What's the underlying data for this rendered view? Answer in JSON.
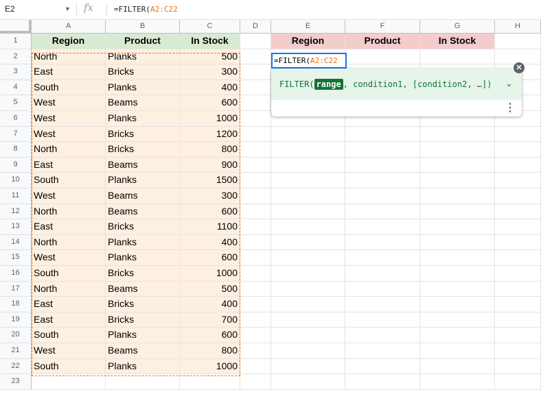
{
  "formula_bar": {
    "cell_ref": "E2",
    "fx_icon": "fx-icon",
    "formula_prefix": "=FILTER(",
    "formula_range": "A2:C22"
  },
  "columns": [
    "A",
    "B",
    "C",
    "D",
    "E",
    "F",
    "G",
    "H"
  ],
  "rows": [
    "1",
    "2",
    "3",
    "4",
    "5",
    "6",
    "7",
    "8",
    "9",
    "10",
    "11",
    "12",
    "13",
    "14",
    "15",
    "16",
    "17",
    "18",
    "19",
    "20",
    "21",
    "22",
    "23"
  ],
  "source_headers": [
    "Region",
    "Product",
    "In Stock"
  ],
  "source_data": [
    [
      "North",
      "Planks",
      "500"
    ],
    [
      "East",
      "Bricks",
      "300"
    ],
    [
      "South",
      "Planks",
      "400"
    ],
    [
      "West",
      "Beams",
      "600"
    ],
    [
      "West",
      "Planks",
      "1000"
    ],
    [
      "West",
      "Bricks",
      "1200"
    ],
    [
      "North",
      "Bricks",
      "800"
    ],
    [
      "East",
      "Beams",
      "900"
    ],
    [
      "South",
      "Planks",
      "1500"
    ],
    [
      "West",
      "Beams",
      "300"
    ],
    [
      "North",
      "Beams",
      "600"
    ],
    [
      "East",
      "Bricks",
      "1100"
    ],
    [
      "North",
      "Planks",
      "400"
    ],
    [
      "West",
      "Planks",
      "600"
    ],
    [
      "South",
      "Bricks",
      "1000"
    ],
    [
      "North",
      "Beams",
      "500"
    ],
    [
      "East",
      "Bricks",
      "400"
    ],
    [
      "East",
      "Bricks",
      "700"
    ],
    [
      "South",
      "Planks",
      "600"
    ],
    [
      "West",
      "Beams",
      "800"
    ],
    [
      "South",
      "Planks",
      "1000"
    ]
  ],
  "output_headers": [
    "Region",
    "Product",
    "In Stock"
  ],
  "active_cell": {
    "prefix": "=FILTER(",
    "range": "A2:C22"
  },
  "formula_help": {
    "fn": "FILTER(",
    "arg_active": "range",
    "rest": ", condition1, [condition2, …])",
    "chevron_icon": "chevron-down-icon",
    "more_icon": "more-vert-icon",
    "close_icon": "close-icon"
  },
  "colors": {
    "source_header_bg": "#d9ead3",
    "source_data_bg": "#fdf0e1",
    "output_header_bg": "#f4cccc",
    "range_highlight": "#e8710a",
    "active_border": "#1a73e8"
  }
}
